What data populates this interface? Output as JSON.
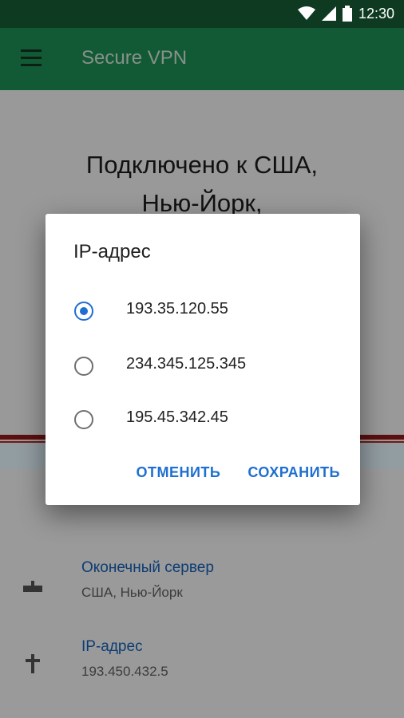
{
  "status_bar": {
    "time": "12:30",
    "icons": [
      "wifi-icon",
      "signal-icon",
      "battery-icon"
    ]
  },
  "app_bar": {
    "title": "Secure VPN",
    "menu_icon": "menu-icon"
  },
  "connection": {
    "line1": "Подключено к США,",
    "line2": "Нью-Йорк,"
  },
  "info": [
    {
      "title": "Оконечный сервер",
      "subtitle": "США, Нью-Йорк",
      "icon": "server-icon"
    },
    {
      "title": "IP-адрес",
      "subtitle": "193.450.432.5",
      "icon": "signpost-icon"
    }
  ],
  "dialog": {
    "title": "IP-адрес",
    "options": [
      {
        "label": "193.35.120.55",
        "selected": true
      },
      {
        "label": "234.345.125.345",
        "selected": false
      },
      {
        "label": "195.45.342.45",
        "selected": false
      }
    ],
    "cancel_label": "ОТМЕНИТЬ",
    "save_label": "СОХРАНИТЬ"
  },
  "colors": {
    "accent": "#1e6fd0",
    "app_bar": "#125a35",
    "status_bar": "#0e3a22"
  }
}
